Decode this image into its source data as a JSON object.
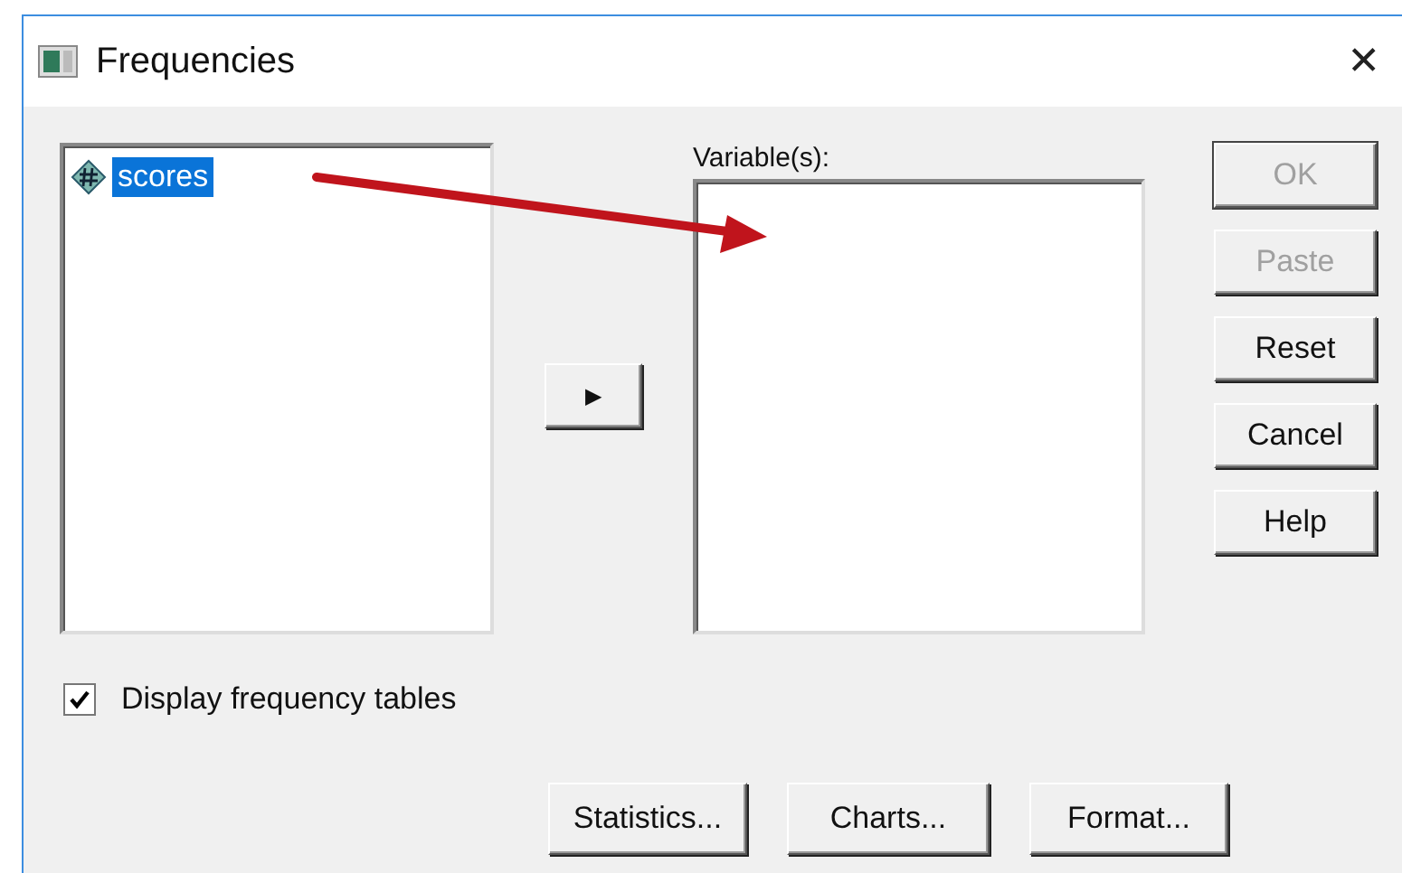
{
  "window": {
    "title": "Frequencies",
    "close": "✕"
  },
  "source_list": {
    "items": [
      {
        "label": "scores",
        "selected": true
      }
    ]
  },
  "move_button": {
    "label": "▶"
  },
  "target_list": {
    "label": "Variable(s):"
  },
  "side_buttons": [
    {
      "label": "OK",
      "disabled": true,
      "default": true
    },
    {
      "label": "Paste",
      "disabled": true,
      "default": false
    },
    {
      "label": "Reset",
      "disabled": false,
      "default": false
    },
    {
      "label": "Cancel",
      "disabled": false,
      "default": false
    },
    {
      "label": "Help",
      "disabled": false,
      "default": false
    }
  ],
  "checkbox": {
    "label": "Display frequency tables",
    "checked": true
  },
  "bottom_buttons": [
    {
      "label": "Statistics..."
    },
    {
      "label": "Charts..."
    },
    {
      "label": "Format..."
    }
  ]
}
